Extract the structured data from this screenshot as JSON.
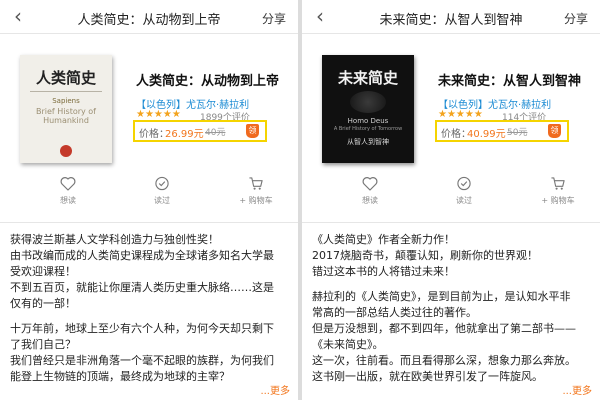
{
  "left": {
    "nav": {
      "title": "人类简史：从动物到上帝",
      "share": "分享",
      "back": "‹"
    },
    "cover": {
      "title": "人类简史",
      "subtitle": "Sapiens",
      "english": "Brief History of Humankind"
    },
    "book": {
      "title": "人类简史：从动物到上帝",
      "author": "【以色列】尤瓦尔·赫拉利",
      "stars": "★★★★★",
      "reviews": "1899个评价",
      "price_label": "价格：",
      "price": "26.99元",
      "old_price": "40元",
      "badge": "领"
    },
    "actions": [
      {
        "label": "想读",
        "icon": "heart-icon"
      },
      {
        "label": "读过",
        "icon": "check-circle-icon"
      },
      {
        "label": "+ 购物车",
        "icon": "cart-icon"
      }
    ],
    "description": [
      "获得波兰斯基人文学科创造力与独创性奖！",
      "由书改编而成的人类简史课程成为全球诸多知名大学最",
      "受欢迎课程！",
      "不到五百页，就能让你厘清人类历史重大脉络……这是",
      "仅有的一部！",
      "",
      "十万年前，地球上至少有六个人种，为何今天却只剩下",
      "了我们自己？",
      "我们曾经只是非洲角落一个毫不起眼的族群，为何我们",
      "能登上生物链的顶端，最终成为地球的主宰？"
    ],
    "more": "...更多"
  },
  "right": {
    "nav": {
      "title": "未来简史：从智人到智神",
      "share": "分享",
      "back": "‹"
    },
    "cover": {
      "title": "未来简史",
      "subtitle": "Homo Deus",
      "english": "A Brief History of Tomorrow",
      "cn_sub": "从智人到智神"
    },
    "book": {
      "title": "未来简史：从智人到智神",
      "author": "【以色列】尤瓦尔·赫拉利",
      "stars": "★★★★★",
      "reviews": "114个评价",
      "price_label": "价格：",
      "price": "40.99元",
      "old_price": "50元",
      "badge": "领"
    },
    "actions": [
      {
        "label": "想读",
        "icon": "heart-icon"
      },
      {
        "label": "读过",
        "icon": "check-circle-icon"
      },
      {
        "label": "+ 购物车",
        "icon": "cart-icon"
      }
    ],
    "description": [
      "《人类简史》作者全新力作！",
      "2017烧脑奇书，颠覆认知，刷新你的世界观！",
      "错过这本书的人将错过未来！",
      "",
      "赫拉利的《人类简史》，是到目前为止，是认知水平非",
      "常高的一部总结人类过往的著作。",
      "但是万没想到，都不到四年，他就拿出了第二部书——",
      "《未来简史》。",
      "这一次，往前看。而且看得那么深，想象力那么奔放。",
      "这书刚一出版，就在欧美世界引发了一阵旋风。"
    ],
    "more": "...更多"
  },
  "colors": {
    "accent": "#f2761d",
    "link": "#1a8ad3",
    "highlight": "#f5d400",
    "star": "#f3a31d"
  }
}
